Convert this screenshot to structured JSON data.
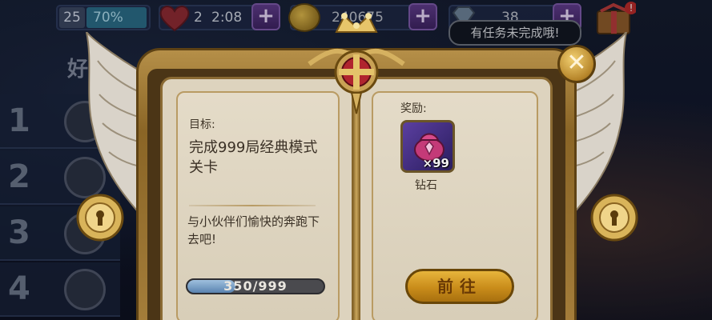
{
  "topbar": {
    "level": "25",
    "level_percent": "70%",
    "hearts_count": "2",
    "hearts_timer": "2:08",
    "coins": "240675",
    "gems": "38",
    "plus_symbol": "+"
  },
  "task_notice": "有任务未完成哦!",
  "left_panel": {
    "title": "好",
    "ranks": [
      "1",
      "2",
      "3",
      "4"
    ]
  },
  "modal": {
    "close_symbol": "✕",
    "goal_label": "目标:",
    "goal_text": "完成999局经典模式关卡",
    "description": "与小伙伴们愉快的奔跑下去吧!",
    "progress_current": 350,
    "progress_total": 999,
    "progress_text": "350/999",
    "reward_label": "奖励:",
    "reward_qty": "×99",
    "reward_name": "钻石",
    "go_button": "前往"
  },
  "colors": {
    "page": "#ddd3be",
    "gold": "#c98c1a",
    "progress_fill": "#7aa0c8"
  },
  "icons": [
    "heart-icon",
    "coin-icon",
    "gem-icon",
    "gift-icon",
    "close-icon",
    "lock-icon",
    "crown-crest-icon",
    "diamond-bag-icon",
    "wing-icon"
  ]
}
